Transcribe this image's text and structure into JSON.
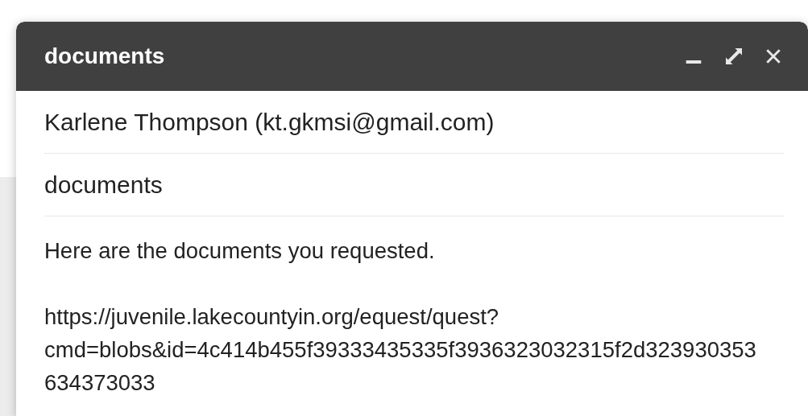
{
  "window": {
    "title": "documents",
    "controls": [
      {
        "kind": "minimize"
      },
      {
        "kind": "expand"
      },
      {
        "kind": "close"
      }
    ]
  },
  "recipient": "Karlene Thompson (kt.gkmsi@gmail.com)",
  "subject": "documents",
  "body": {
    "message": "Here are the documents you requested.",
    "link_lines": [
      "https://juvenile.lakecountyin.org/equest/quest?",
      "cmd=blobs&id=4c414b455f39333435335f3936323032315f2d323930353",
      "634373033"
    ]
  }
}
